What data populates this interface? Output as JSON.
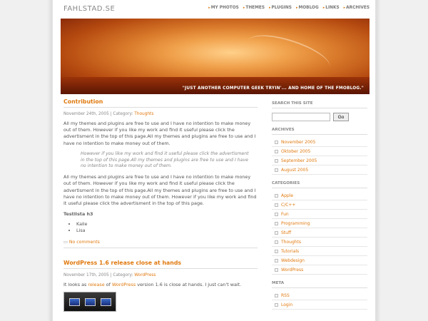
{
  "site": {
    "logo": "FAHLSTAD.SE"
  },
  "nav": [
    {
      "label": "MY PHOTOS"
    },
    {
      "label": "THEMES"
    },
    {
      "label": "PLUGINS"
    },
    {
      "label": "MOBLOG"
    },
    {
      "label": "LINKS"
    },
    {
      "label": "ARCHIVES"
    }
  ],
  "banner": {
    "tagline": "\"JUST ANOTHER COMPUTER GEEK TRYIN'... AND HOME OF THE FMOBLOG.\""
  },
  "post1": {
    "title": "Contribution",
    "meta_prefix": "November 24th, 2005 | Category: ",
    "category": "Thoughts",
    "para1": "All my themes and plugins are free to use and I have no intention to make money out of them. However if you like my work and find it useful please click the advertisment in the top of this page.All my themes and plugins are free to use and I have no intention to make money out of them.",
    "quote": "However if you like my work and find it useful please click the advertisment in the top of this page.All my themes and plugins are free to use and I have no intention to make money out of them.",
    "para2": "All my themes and plugins are free to use and I have no intention to make money out of them. However if you like my work and find it useful please click the advertisment in the top of this page.All my themes and plugins are free to use and I have no intention to make money out of them. However if you like my work and find it useful please click the advertisment in the top of this page.",
    "h3": "Testlista h3",
    "list": [
      "Kalle",
      "Lisa"
    ],
    "comments": "No comments"
  },
  "post2": {
    "title": "WordPress 1.6 release close at hands",
    "meta_prefix": "November 17th, 2005 | Category: ",
    "category": "WordPress",
    "text_a": "It looks as ",
    "link1": "release",
    "text_b": " of ",
    "link2": "WordPress",
    "text_c": " version 1.6 is close at hands. I just can't wait."
  },
  "sidebar": {
    "search_title": "SEARCH THIS SITE",
    "search_button": "Go",
    "archives_title": "ARCHIVES",
    "archives": [
      "November 2005",
      "Oktober 2005",
      "September 2005",
      "August 2005"
    ],
    "categories_title": "CATEGORIES",
    "categories": [
      "Apple",
      "C/C++",
      "Fun",
      "Programming",
      "Stuff",
      "Thoughts",
      "Tutorials",
      "Webdesign",
      "WordPress"
    ],
    "meta_title": "META",
    "meta": [
      "RSS",
      "Login"
    ]
  },
  "colors": {
    "accent": "#e07a10"
  }
}
